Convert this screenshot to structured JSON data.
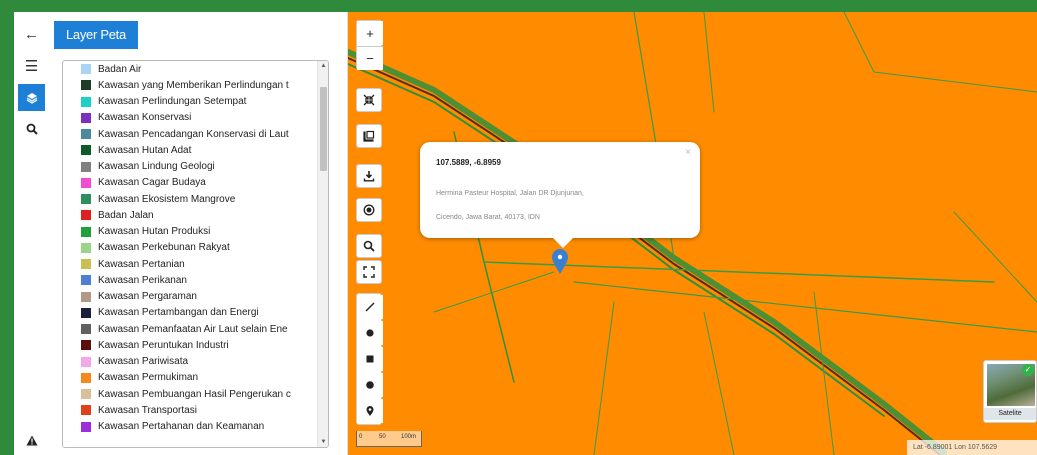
{
  "rail": {
    "back_icon": "arrow-left-icon",
    "menu_icon": "hamburger-icon",
    "layers_icon": "layers-icon",
    "search_icon": "search-icon",
    "warning_icon": "warning-icon"
  },
  "panel": {
    "title": "Layer Peta"
  },
  "legend": [
    {
      "label": "Badan Air",
      "color": "#aad4f5"
    },
    {
      "label": "Kawasan yang Memberikan Perlindungan t",
      "color": "#1f3d26"
    },
    {
      "label": "Kawasan Perlindungan Setempat",
      "color": "#1ecfc4"
    },
    {
      "label": "Kawasan Konservasi",
      "color": "#7b2fbe"
    },
    {
      "label": "Kawasan Pencadangan Konservasi di Laut",
      "color": "#4a8a9c"
    },
    {
      "label": "Kawasan Hutan Adat",
      "color": "#0f5a2a"
    },
    {
      "label": "Kawasan Lindung Geologi",
      "color": "#808080"
    },
    {
      "label": "Kawasan Cagar Budaya",
      "color": "#f24fd0"
    },
    {
      "label": "Kawasan Ekosistem Mangrove",
      "color": "#2e8f5e"
    },
    {
      "label": "Badan Jalan",
      "color": "#e02020"
    },
    {
      "label": "Kawasan Hutan Produksi",
      "color": "#1fa03c"
    },
    {
      "label": "Kawasan Perkebunan Rakyat",
      "color": "#9ad48c"
    },
    {
      "label": "Kawasan Pertanian",
      "color": "#c8c050"
    },
    {
      "label": "Kawasan Perikanan",
      "color": "#4d7fd6"
    },
    {
      "label": "Kawasan Pergaraman",
      "color": "#b09a86"
    },
    {
      "label": "Kawasan Pertambangan dan Energi",
      "color": "#1a1f3a"
    },
    {
      "label": "Kawasan Pemanfaatan Air Laut selain Ene",
      "color": "#606060"
    },
    {
      "label": "Kawasan Peruntukan Industri",
      "color": "#5a0f0f"
    },
    {
      "label": "Kawasan Pariwisata",
      "color": "#f5a8e8"
    },
    {
      "label": "Kawasan Permukiman",
      "color": "#f5891e"
    },
    {
      "label": "Kawasan Pembuangan Hasil Pengerukan c",
      "color": "#d9c09a"
    },
    {
      "label": "Kawasan Transportasi",
      "color": "#e0401a"
    },
    {
      "label": "Kawasan Pertahanan dan Keamanan",
      "color": "#9b2fe0"
    }
  ],
  "toolbar": {
    "zoom_in": "+",
    "zoom_out": "−",
    "icons": [
      "zoom-in-icon",
      "zoom-out-icon",
      "fullscreen-exit-icon",
      "basemap-square-icon",
      "download-icon",
      "locate-icon",
      "search-map-icon",
      "extent-icon",
      "draw-line-icon",
      "draw-point-icon",
      "draw-square-icon",
      "draw-circle-icon",
      "marker-icon"
    ]
  },
  "popup": {
    "coords": "107.5889, -6.8959",
    "address_line1": "Hermina Pasteur Hospital, Jalan DR Djunjunan,",
    "address_line2": "Cicendo, Jawa Barat, 40173, IDN",
    "close": "×"
  },
  "basemap": {
    "label": "Satelite"
  },
  "scale": {
    "label0": "0",
    "label1": "50",
    "label2": "100m"
  },
  "coords_bar": {
    "text": "Lat -6.89001  Lon 107.5629"
  },
  "colors": {
    "map_fill": "#ff8c00",
    "accent": "#1e7fd6",
    "road_dark": "#5a2a14",
    "road_green": "#2f8f3c"
  }
}
